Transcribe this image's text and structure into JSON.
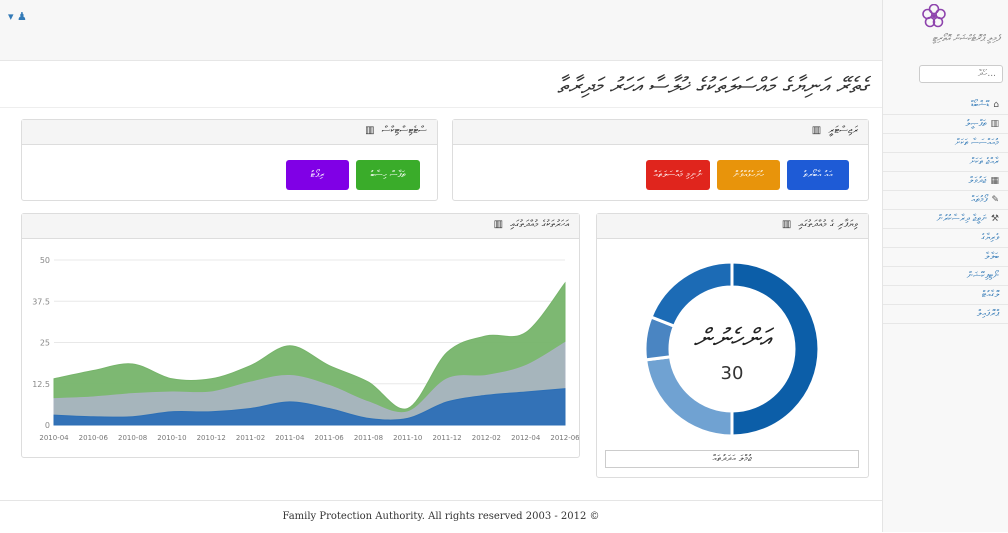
{
  "topbar": {
    "user_menu": "▾ ♟"
  },
  "page": {
    "title": "ގެތެރޭ އަނިޔާގެ މައްސަލަތަކުގެ ޚުލާސާ އަހަރު މަދިރާތާ"
  },
  "panels": {
    "top_right": {
      "title": "ރަޖިސްޓަރީ",
      "icon": "bar-chart-icon",
      "buttons": [
        {
          "label": "އައު އާބޯރތު",
          "color": "#1e5bd6"
        },
        {
          "label": "ހުށަހެޅުއްވުން",
          "color": "#e8940b"
        },
        {
          "label": "ނުނިމި މައްސަލަތައް",
          "color": "#e0251d"
        }
      ]
    },
    "top_left": {
      "title": "ސްޓެޓިސްޓިކްސް",
      "icon": "bar-chart-icon",
      "buttons": [
        {
          "label": "ތަފާސް ހިސާބު",
          "color": "#3aac2a"
        },
        {
          "label": "ރިޕޯޓު",
          "color": "#8000e6"
        }
      ]
    },
    "area_chart": {
      "title": "އަހަރުތަކުގެ މުއްދަތުގައި",
      "icon": "bar-chart-icon"
    },
    "donut": {
      "title": "ވިޔަފާރި ގެ މުއްދަތުގައި",
      "icon": "bar-chart-icon",
      "center_label": "އަންހެނުން",
      "center_value": "30",
      "legend": "ޖުމްލަ އަދަދުތައް"
    }
  },
  "chart_data": [
    {
      "type": "area",
      "x": [
        "2010-04",
        "2010-06",
        "2010-08",
        "2010-10",
        "2010-12",
        "2011-02",
        "2011-04",
        "2011-06",
        "2011-08",
        "2011-10",
        "2011-12",
        "2012-02",
        "2012-04",
        "2012-06"
      ],
      "ylim": [
        0,
        50
      ],
      "yticks": [
        "0",
        "12.5",
        "25",
        "37.5",
        "50"
      ],
      "grid": true,
      "series": [
        {
          "values": [
            3,
            2.5,
            2.5,
            4,
            4,
            5,
            7,
            5,
            2,
            2,
            7,
            9,
            10,
            11
          ],
          "color": "#2c6fb6"
        },
        {
          "values": [
            5,
            6,
            7,
            6,
            6,
            8,
            8,
            7,
            5,
            2,
            7,
            6,
            8,
            14
          ],
          "color": "#a9b4c0"
        },
        {
          "values": [
            6,
            8,
            9,
            4,
            4,
            5,
            9,
            6,
            6,
            1,
            8,
            12,
            10,
            18
          ],
          "color": "#76b46a"
        }
      ]
    },
    {
      "type": "pie",
      "values": [
        50,
        23,
        8,
        19
      ],
      "colors": [
        "#0c5ea8",
        "#70a2d2",
        "#4a85c2",
        "#1c6bb5"
      ]
    }
  ],
  "sidebar": {
    "logo_text": "ފެމިލީ ޕްރޮޓެކްޝަން އޮތޯރިޓީ",
    "search_placeholder": "ހޯދާ...",
    "items": [
      {
        "label": "ޑޭޝްބޯޑް",
        "icon": "home-icon"
      },
      {
        "label": "ތަފްޞީލު",
        "icon": "bar-chart-icon"
      },
      {
        "label": "މުއައްސަސާ ތަކަށް",
        "icon": ""
      },
      {
        "label": "ރާއްޖެ ތަކަށް",
        "icon": ""
      },
      {
        "label": "ޖަދުވަލް",
        "icon": "table-icon"
      },
      {
        "label": "ފޯމުތައް",
        "icon": "edit-icon"
      },
      {
        "label": "ނަތީޖާ ދިރާސާކުރުން",
        "icon": "wrench-icon"
      },
      {
        "label": "ވެރިޔާގެ",
        "icon": ""
      },
      {
        "label": "ބަލާލާ",
        "icon": ""
      },
      {
        "label": "ނޯޓިފިކޭޝަން",
        "icon": ""
      },
      {
        "label": "ލޮގާއުޓް",
        "icon": ""
      },
      {
        "label": "ޕްރޮފައިލް",
        "icon": ""
      }
    ]
  },
  "footer": {
    "text": "Family Protection Authority. All rights reserved 2003 - 2012 ©"
  }
}
